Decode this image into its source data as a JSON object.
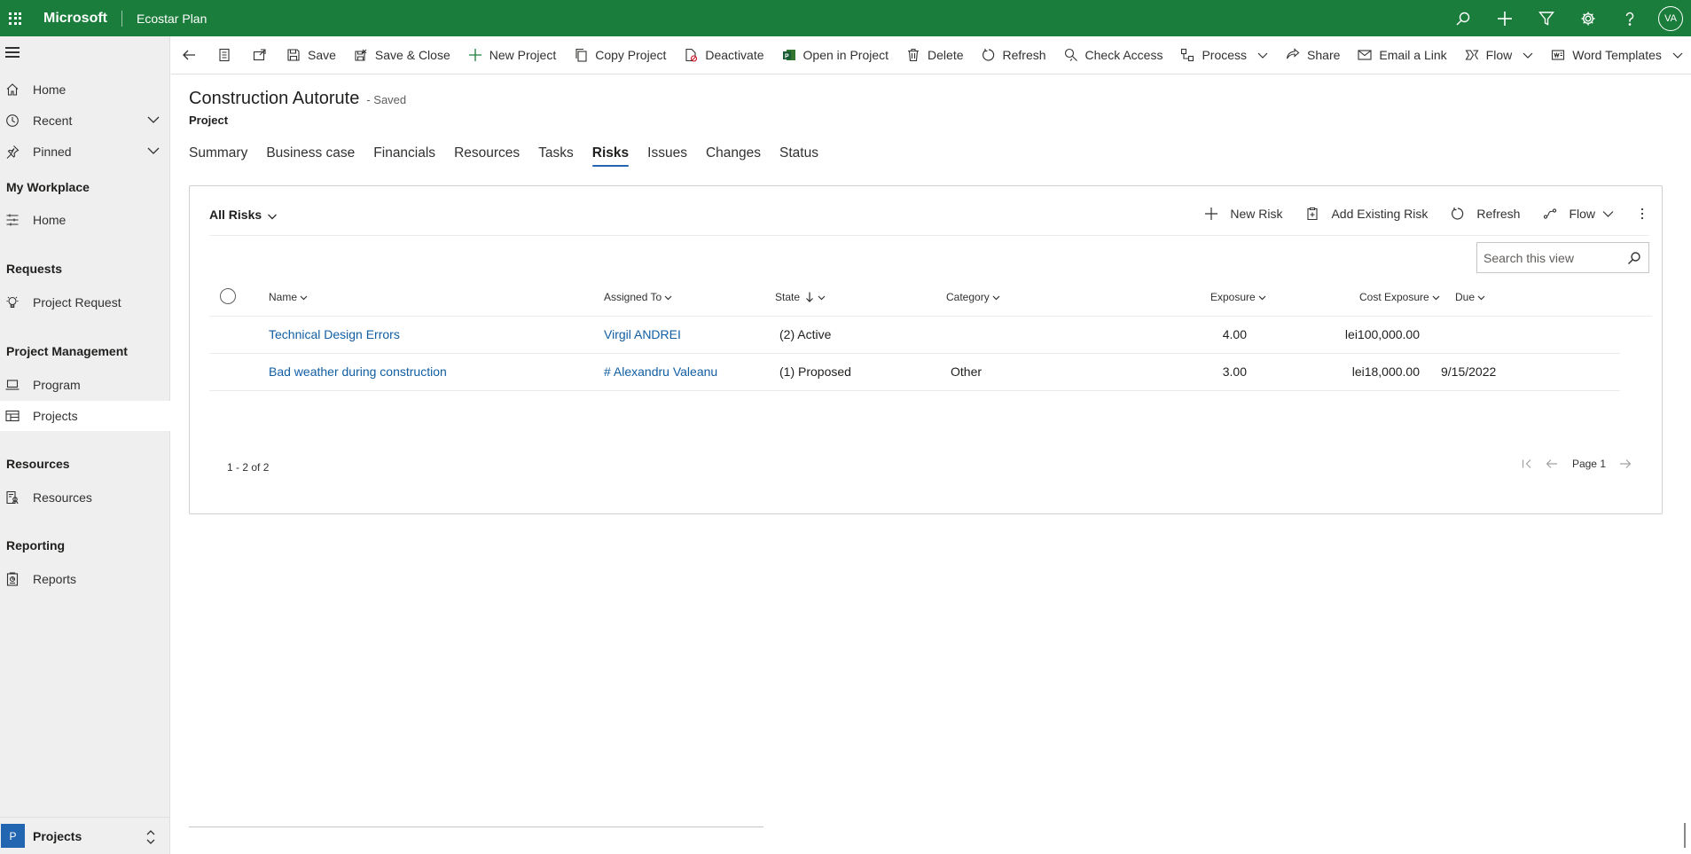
{
  "header": {
    "brand": "Microsoft",
    "app_name": "Ecostar Plan",
    "avatar_initials": "VA",
    "accent": "#1b7d3c"
  },
  "sidebar": {
    "top_items": [
      {
        "label": "Home",
        "icon": "home-icon"
      },
      {
        "label": "Recent",
        "icon": "clock-icon"
      },
      {
        "label": "Pinned",
        "icon": "pin-icon"
      }
    ],
    "groups": [
      {
        "title": "My Workplace",
        "items": [
          {
            "label": "Home",
            "icon": "dashboard-icon"
          }
        ]
      },
      {
        "title": "Requests",
        "items": [
          {
            "label": "Project Request",
            "icon": "lightbulb-icon"
          }
        ]
      },
      {
        "title": "Project Management",
        "items": [
          {
            "label": "Program",
            "icon": "laptop-icon"
          },
          {
            "label": "Projects",
            "icon": "table-icon"
          }
        ]
      },
      {
        "title": "Resources",
        "items": [
          {
            "label": "Resources",
            "icon": "resource-icon"
          }
        ]
      },
      {
        "title": "Reporting",
        "items": [
          {
            "label": "Reports",
            "icon": "report-icon"
          }
        ]
      }
    ],
    "area": {
      "badge": "P",
      "label": "Projects"
    }
  },
  "commandbar": {
    "save": "Save",
    "save_close": "Save & Close",
    "new_project": "New Project",
    "copy_project": "Copy Project",
    "deactivate": "Deactivate",
    "open_in_project": "Open in Project",
    "delete": "Delete",
    "refresh": "Refresh",
    "check_access": "Check Access",
    "process": "Process",
    "share": "Share",
    "email_link": "Email a Link",
    "flow": "Flow",
    "word_templates": "Word Templates"
  },
  "record": {
    "title": "Construction Autorute",
    "saved_status": "- Saved",
    "entity": "Project"
  },
  "tabs": [
    "Summary",
    "Business case",
    "Financials",
    "Resources",
    "Tasks",
    "Risks",
    "Issues",
    "Changes",
    "Status"
  ],
  "subgrid": {
    "view_name": "All Risks",
    "commands": {
      "new_risk": "New Risk",
      "add_existing": "Add Existing Risk",
      "refresh": "Refresh",
      "flow": "Flow"
    },
    "search_placeholder": "Search this view",
    "columns": {
      "name": "Name",
      "assigned_to": "Assigned To",
      "state": "State",
      "category": "Category",
      "exposure": "Exposure",
      "cost_exposure": "Cost Exposure",
      "due": "Due"
    },
    "rows": [
      {
        "name": "Technical Design Errors",
        "assigned_to": "Virgil ANDREI",
        "state": "(2) Active",
        "category": "",
        "exposure": "4.00",
        "cost_exposure": "lei100,000.00",
        "due": ""
      },
      {
        "name": "Bad weather during construction",
        "assigned_to": "# Alexandru Valeanu",
        "state": "(1) Proposed",
        "category": "Other",
        "exposure": "3.00",
        "cost_exposure": "lei18,000.00",
        "due": "9/15/2022"
      }
    ],
    "count_label": "1 - 2 of 2",
    "page_label": "Page 1"
  }
}
